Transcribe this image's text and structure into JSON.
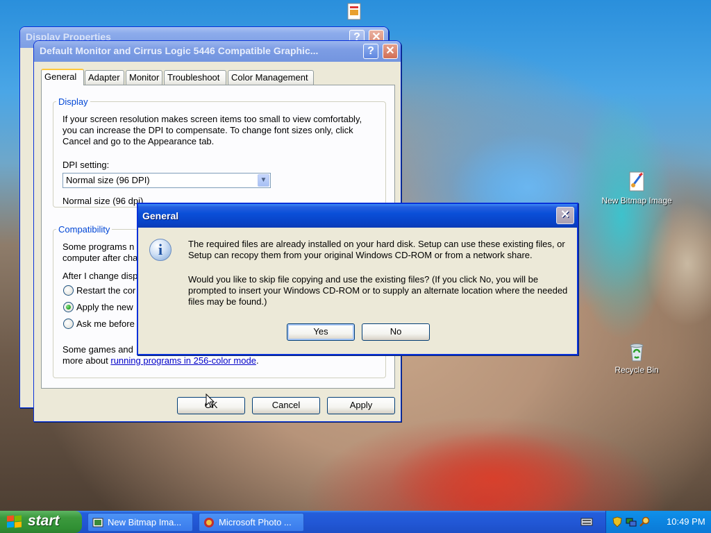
{
  "display_properties": {
    "title": "Display Properties"
  },
  "monitor_dialog": {
    "title": "Default Monitor and Cirrus Logic 5446 Compatible Graphic...",
    "tabs": [
      "General",
      "Adapter",
      "Monitor",
      "Troubleshoot",
      "Color Management"
    ],
    "display_group": {
      "legend": "Display",
      "description": "If your screen resolution makes screen items too small to view comfortably, you can increase the DPI to compensate.  To change font sizes only, click Cancel and go to the Appearance tab.",
      "dpi_label": "DPI setting:",
      "dpi_value": "Normal size (96 DPI)",
      "dpi_current": "Normal size (96 dpi)"
    },
    "compat_group": {
      "legend": "Compatibility",
      "text1": "Some programs n",
      "text2": "computer after cha",
      "change_label": "After I change disp",
      "radio_restart": "Restart the cor",
      "radio_apply": "Apply the new",
      "radio_ask": "Ask me before",
      "games_text": "Some games and",
      "more_prefix": "more about ",
      "link_text": "running programs in 256-color mode",
      "more_suffix": "."
    },
    "buttons": {
      "ok": "OK",
      "cancel": "Cancel",
      "apply": "Apply"
    }
  },
  "general_dialog": {
    "title": "General",
    "message1": "The required files are already installed on your hard disk. Setup can use these existing files, or Setup can recopy them from your original Windows CD-ROM or from a network share.",
    "message2": "Would you like to skip file copying and use the existing files? (If you click No, you will be prompted to insert your Windows CD-ROM or to supply an alternate location where the needed files may be found.)",
    "yes": "Yes",
    "no": "No",
    "icon": "information-icon"
  },
  "desktop_icons": {
    "bitmap": "New Bitmap Image",
    "recycle": "Recycle Bin"
  },
  "taskbar": {
    "start": "start",
    "tasks": [
      "New Bitmap Ima...",
      "Microsoft Photo ..."
    ],
    "clock": "10:49 PM"
  },
  "colors": {
    "title_blue": "#0a4fd8",
    "taskbar_blue": "#245edb",
    "start_green": "#3c9a3e"
  }
}
